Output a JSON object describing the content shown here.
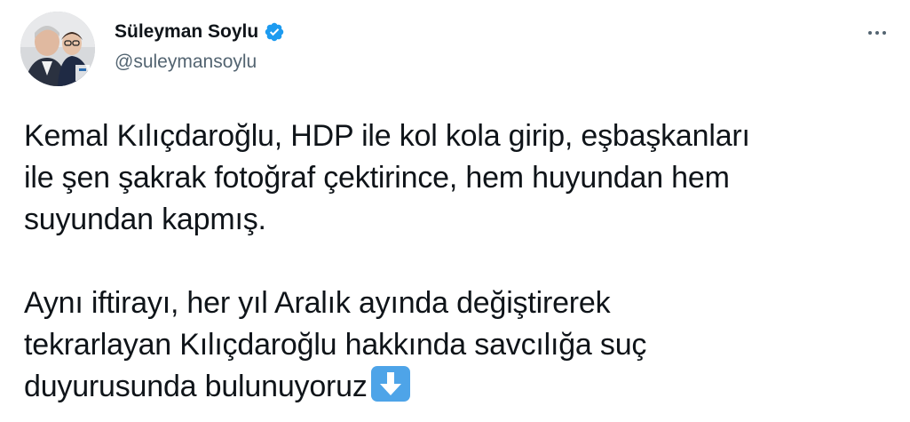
{
  "tweet": {
    "author": {
      "display_name": "Süleyman Soylu",
      "handle": "@suleymansoylu",
      "verified": true,
      "avatar_icon": "profile-photo"
    },
    "menu_icon": "more-horizontal-icon",
    "paragraphs": [
      "Kemal Kılıçdaroğlu, HDP ile kol kola girip, eşbaşkanları\nile şen şakrak fotoğraf çektirince, hem huyundan hem\nsuyundan kapmış.",
      "Aynı iftirayı, her yıl Aralık ayında değiştirerek\ntekrarlayan Kılıçdaroğlu hakkında savcılığa suç\nduyurusunda bulunuyoruz"
    ],
    "trailing_emoji": "down-arrow-emoji"
  },
  "colors": {
    "text": "#0f1419",
    "secondary": "#536471",
    "verified_badge": "#1d9bf0",
    "emoji_blue": "#4ea4e8"
  }
}
